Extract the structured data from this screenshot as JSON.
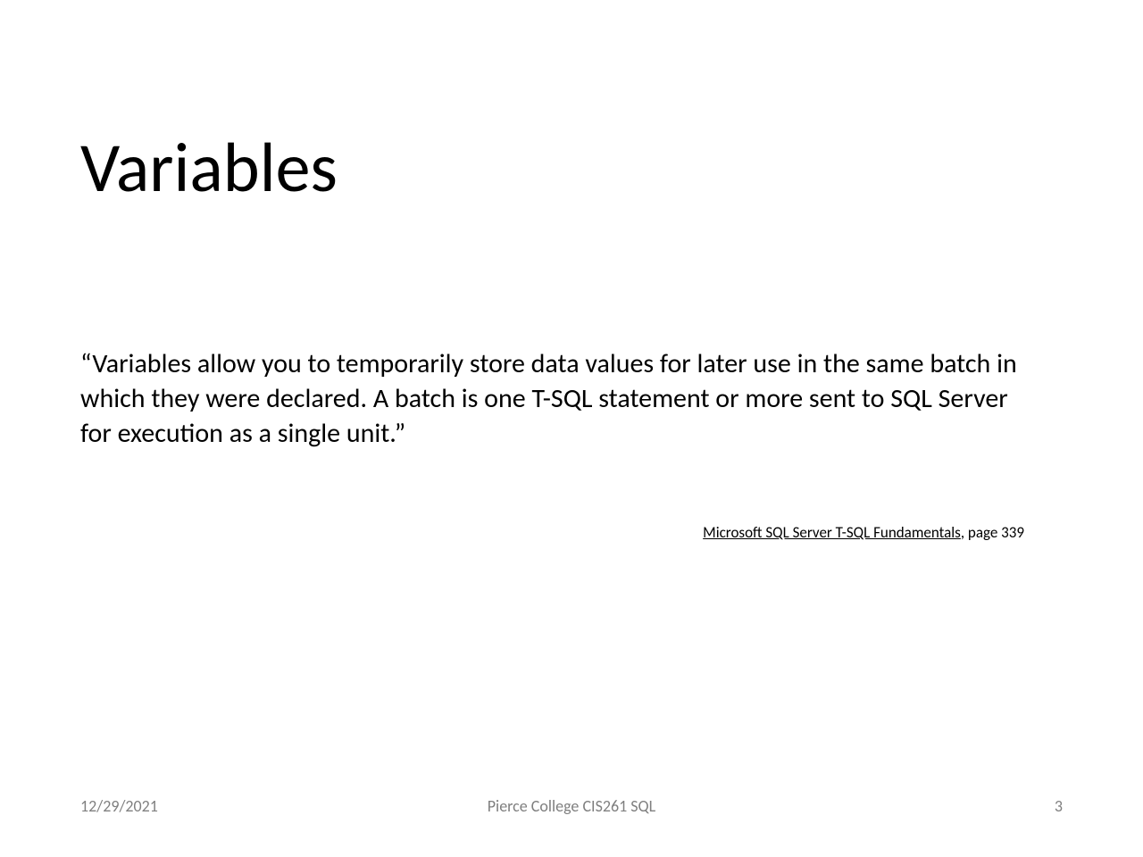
{
  "slide": {
    "title": "Variables",
    "body": "“Variables allow you to temporarily store data values for later use in the same batch in which they were declared. A batch is one T-SQL statement or more sent to SQL Server for execution as a single unit.”",
    "citation_link": "Microsoft SQL Server T-SQL Fundamentals",
    "citation_suffix": ", page 339"
  },
  "footer": {
    "date": "12/29/2021",
    "center": "Pierce College CIS261 SQL",
    "page": "3"
  }
}
